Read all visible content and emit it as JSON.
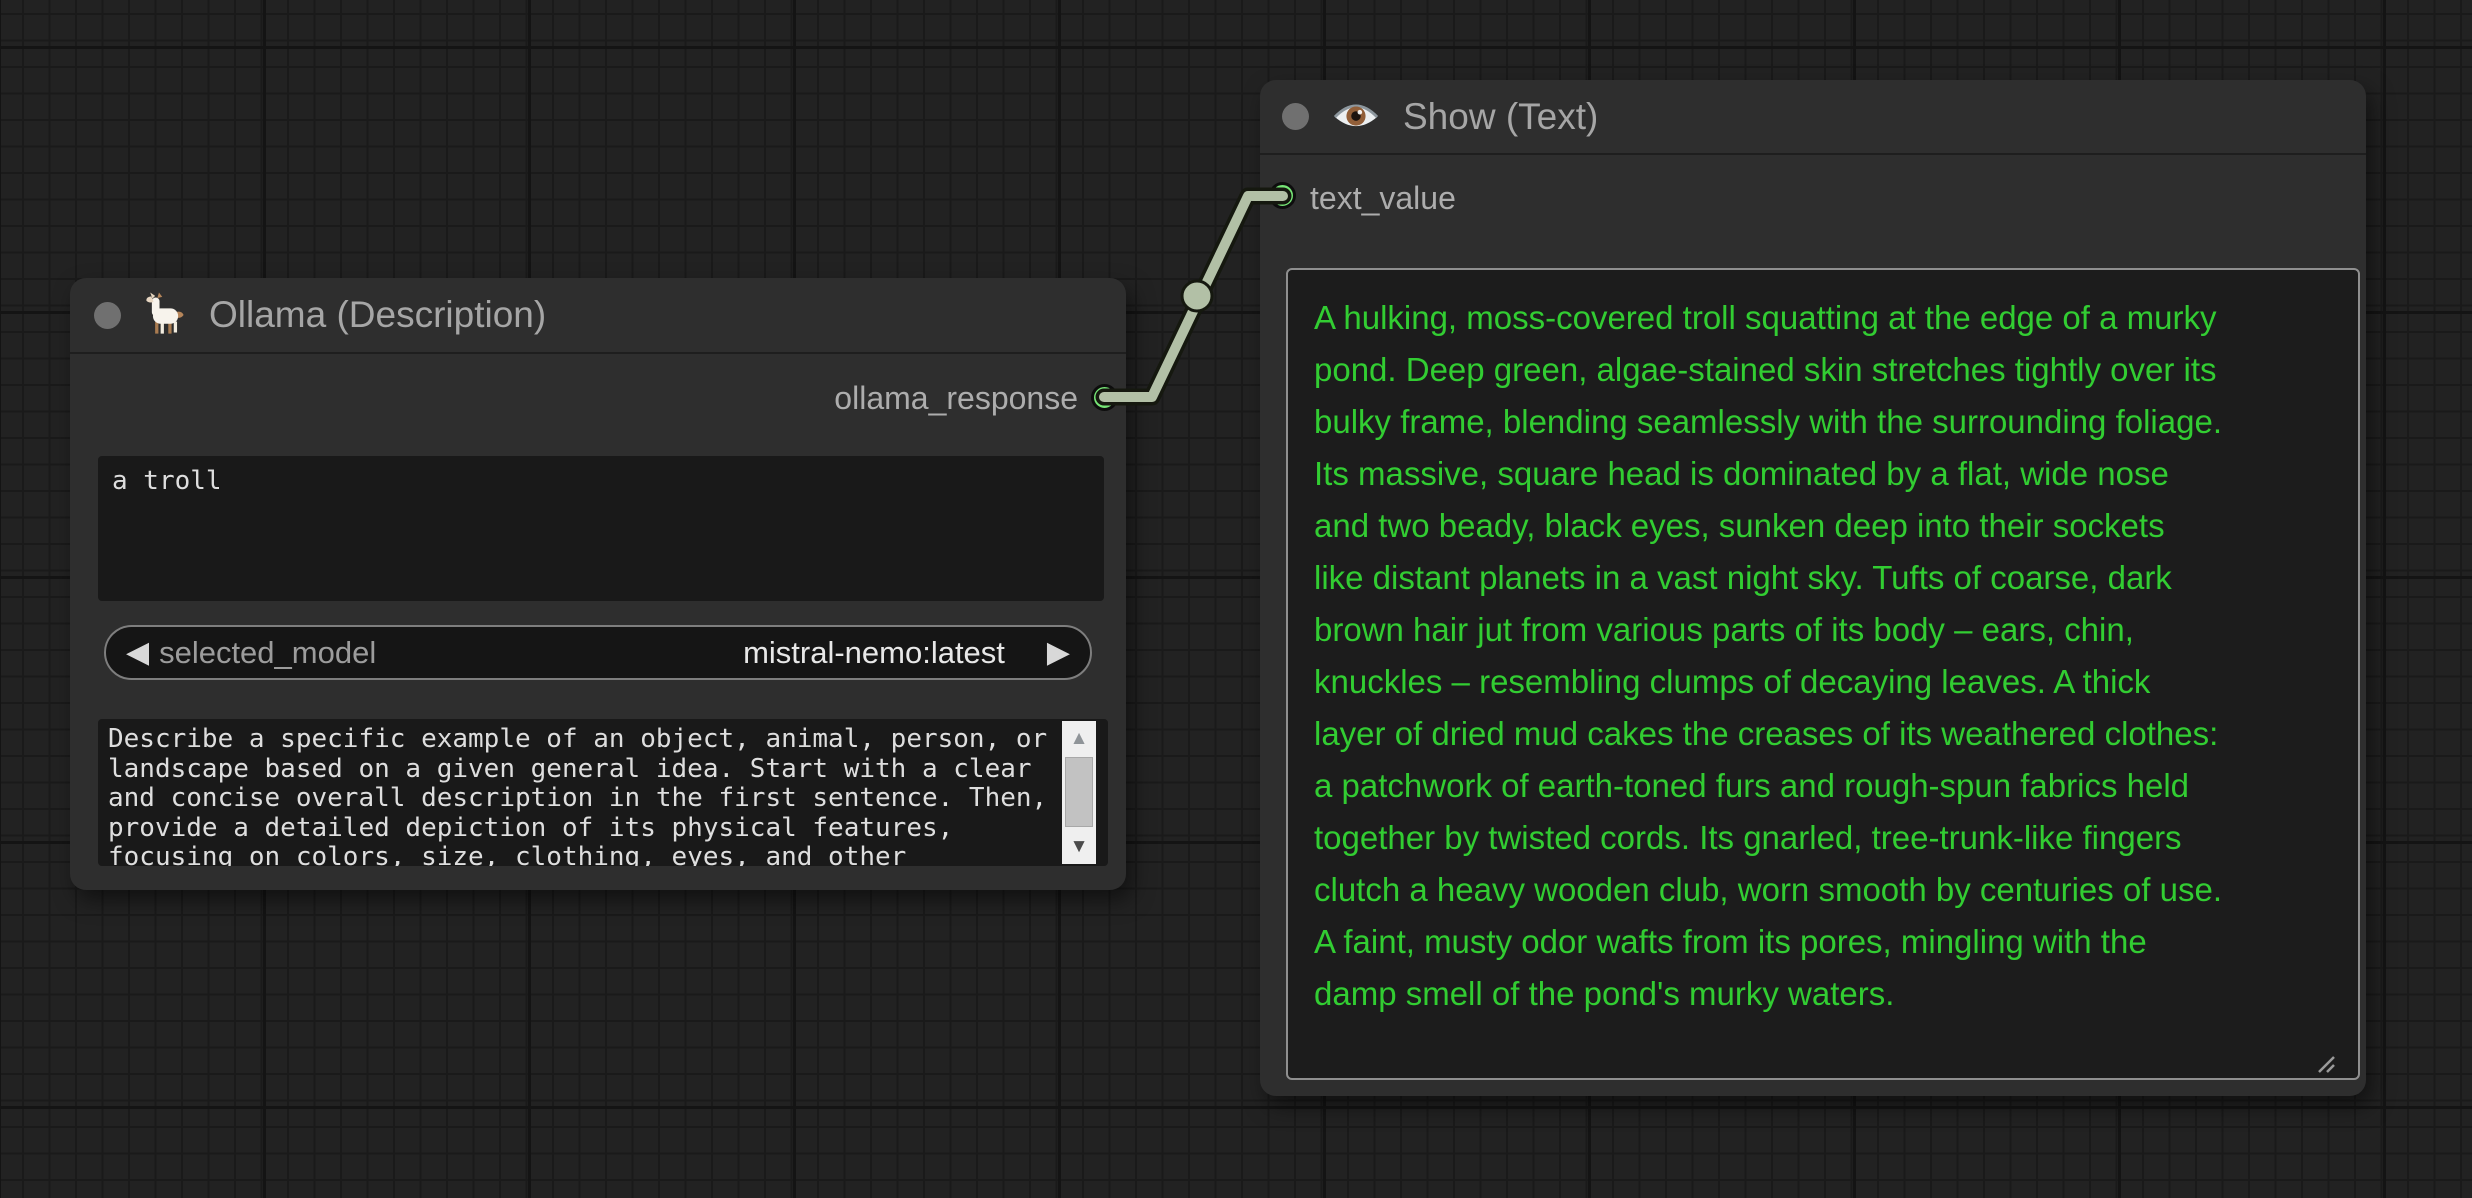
{
  "canvas": {
    "bg_color": "#222222",
    "grid_minor_color": "#1a1a1a",
    "grid_major_color": "#141414"
  },
  "link": {
    "color": "#b2c0a6",
    "outline_color": "#15180f",
    "from": "ollama_response",
    "to": "text_value"
  },
  "colors": {
    "node_bg": "#2e2e2e",
    "slot_dot": "#76e576",
    "show_text_green": "#32cd32",
    "widget_bg": "#191919"
  },
  "ollama": {
    "title": "Ollama (Description)",
    "icon": "llama-icon",
    "output_label": "ollama_response",
    "input_text": "a troll",
    "model_widget": {
      "label": "selected_model",
      "value": "mistral-nemo:latest"
    },
    "prompt_lines": [
      "Describe a specific example of an object, animal, person, or",
      "landscape based on a given general idea. Start with a clear",
      "and concise overall description in the first sentence. Then,",
      "provide a detailed depiction of its physical features,",
      "focusing on colors, size, clothing, eyes, and other"
    ]
  },
  "show": {
    "title": "Show (Text)",
    "icon": "eye-icon",
    "input_label": "text_value",
    "text_lines": [
      "A hulking, moss-covered troll squatting at the edge of a murky",
      "pond. Deep green, algae-stained skin stretches tightly over its",
      "bulky frame, blending seamlessly with the surrounding foliage.",
      "Its massive, square head is dominated by a flat, wide nose",
      "and two beady, black eyes, sunken deep into their sockets",
      "like distant planets in a vast night sky. Tufts of coarse, dark",
      "brown hair jut from various parts of its body – ears, chin,",
      "knuckles – resembling clumps of decaying leaves. A thick",
      "layer of dried mud cakes the creases of its weathered clothes:",
      "a patchwork of earth-toned furs and rough-spun fabrics held",
      "together by twisted cords. Its gnarled, tree-trunk-like fingers",
      "clutch a heavy wooden club, worn smooth by centuries of use.",
      "A faint, musty odor wafts from its pores, mingling with the",
      "damp smell of the pond's murky waters."
    ]
  },
  "icons": {
    "prev": "◀",
    "next": "▶",
    "scroll_up": "▲",
    "scroll_down": "▼"
  }
}
